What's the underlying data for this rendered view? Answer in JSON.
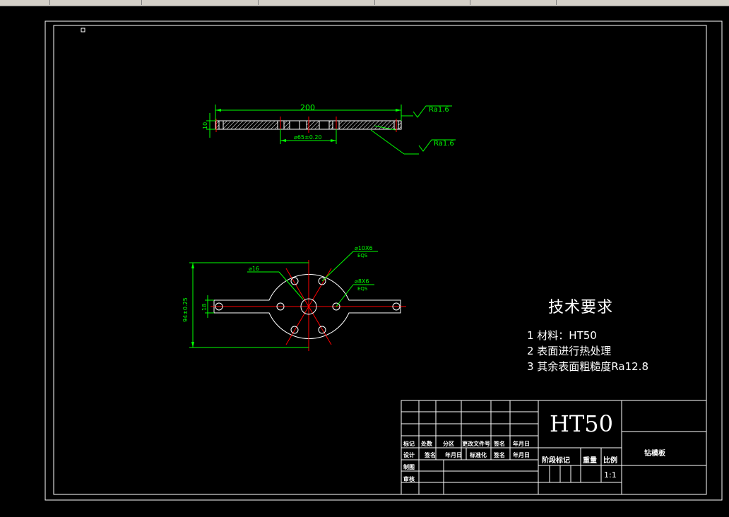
{
  "drawing": {
    "top_view": {
      "length_dim": "200",
      "thickness_dim": "10",
      "center_dim": "⌀65±0.20",
      "roughness_1": "Ra1.6",
      "roughness_2": "Ra1.6"
    },
    "plan_view": {
      "hole_large": "⌀10X6",
      "hole_large_eqs": "EQS",
      "hole_small": "⌀8X6",
      "hole_small_eqs": "EQS",
      "dia_center": "⌀16",
      "height_dim": "94±0.25",
      "width_dim": "18"
    }
  },
  "tech_requirements": {
    "title": "技术要求",
    "items": [
      "1 材料：HT50",
      "2 表面进行热处理",
      "3 其余表面粗糙度Ra12.8"
    ]
  },
  "title_block": {
    "material": "HT50",
    "part_name": "钻模板",
    "scale": "1:1",
    "labels": {
      "mark": "标记",
      "count": "处数",
      "zone": "分区",
      "change_doc": "更改文件号",
      "sign": "签名",
      "date": "年月日",
      "design": "设计",
      "sign2": "签名",
      "date2": "年月日",
      "standardize": "标准化",
      "sign3": "签名",
      "date3": "年月日",
      "draft": "制图",
      "review": "审核",
      "stage_mark": "阶段标记",
      "weight": "重量",
      "ratio": "比例"
    }
  },
  "colors": {
    "background": "#000000",
    "frame": "#ffffff",
    "dimension": "#00ff00",
    "centerline": "#ff0000",
    "hatch": "#ffffff"
  }
}
